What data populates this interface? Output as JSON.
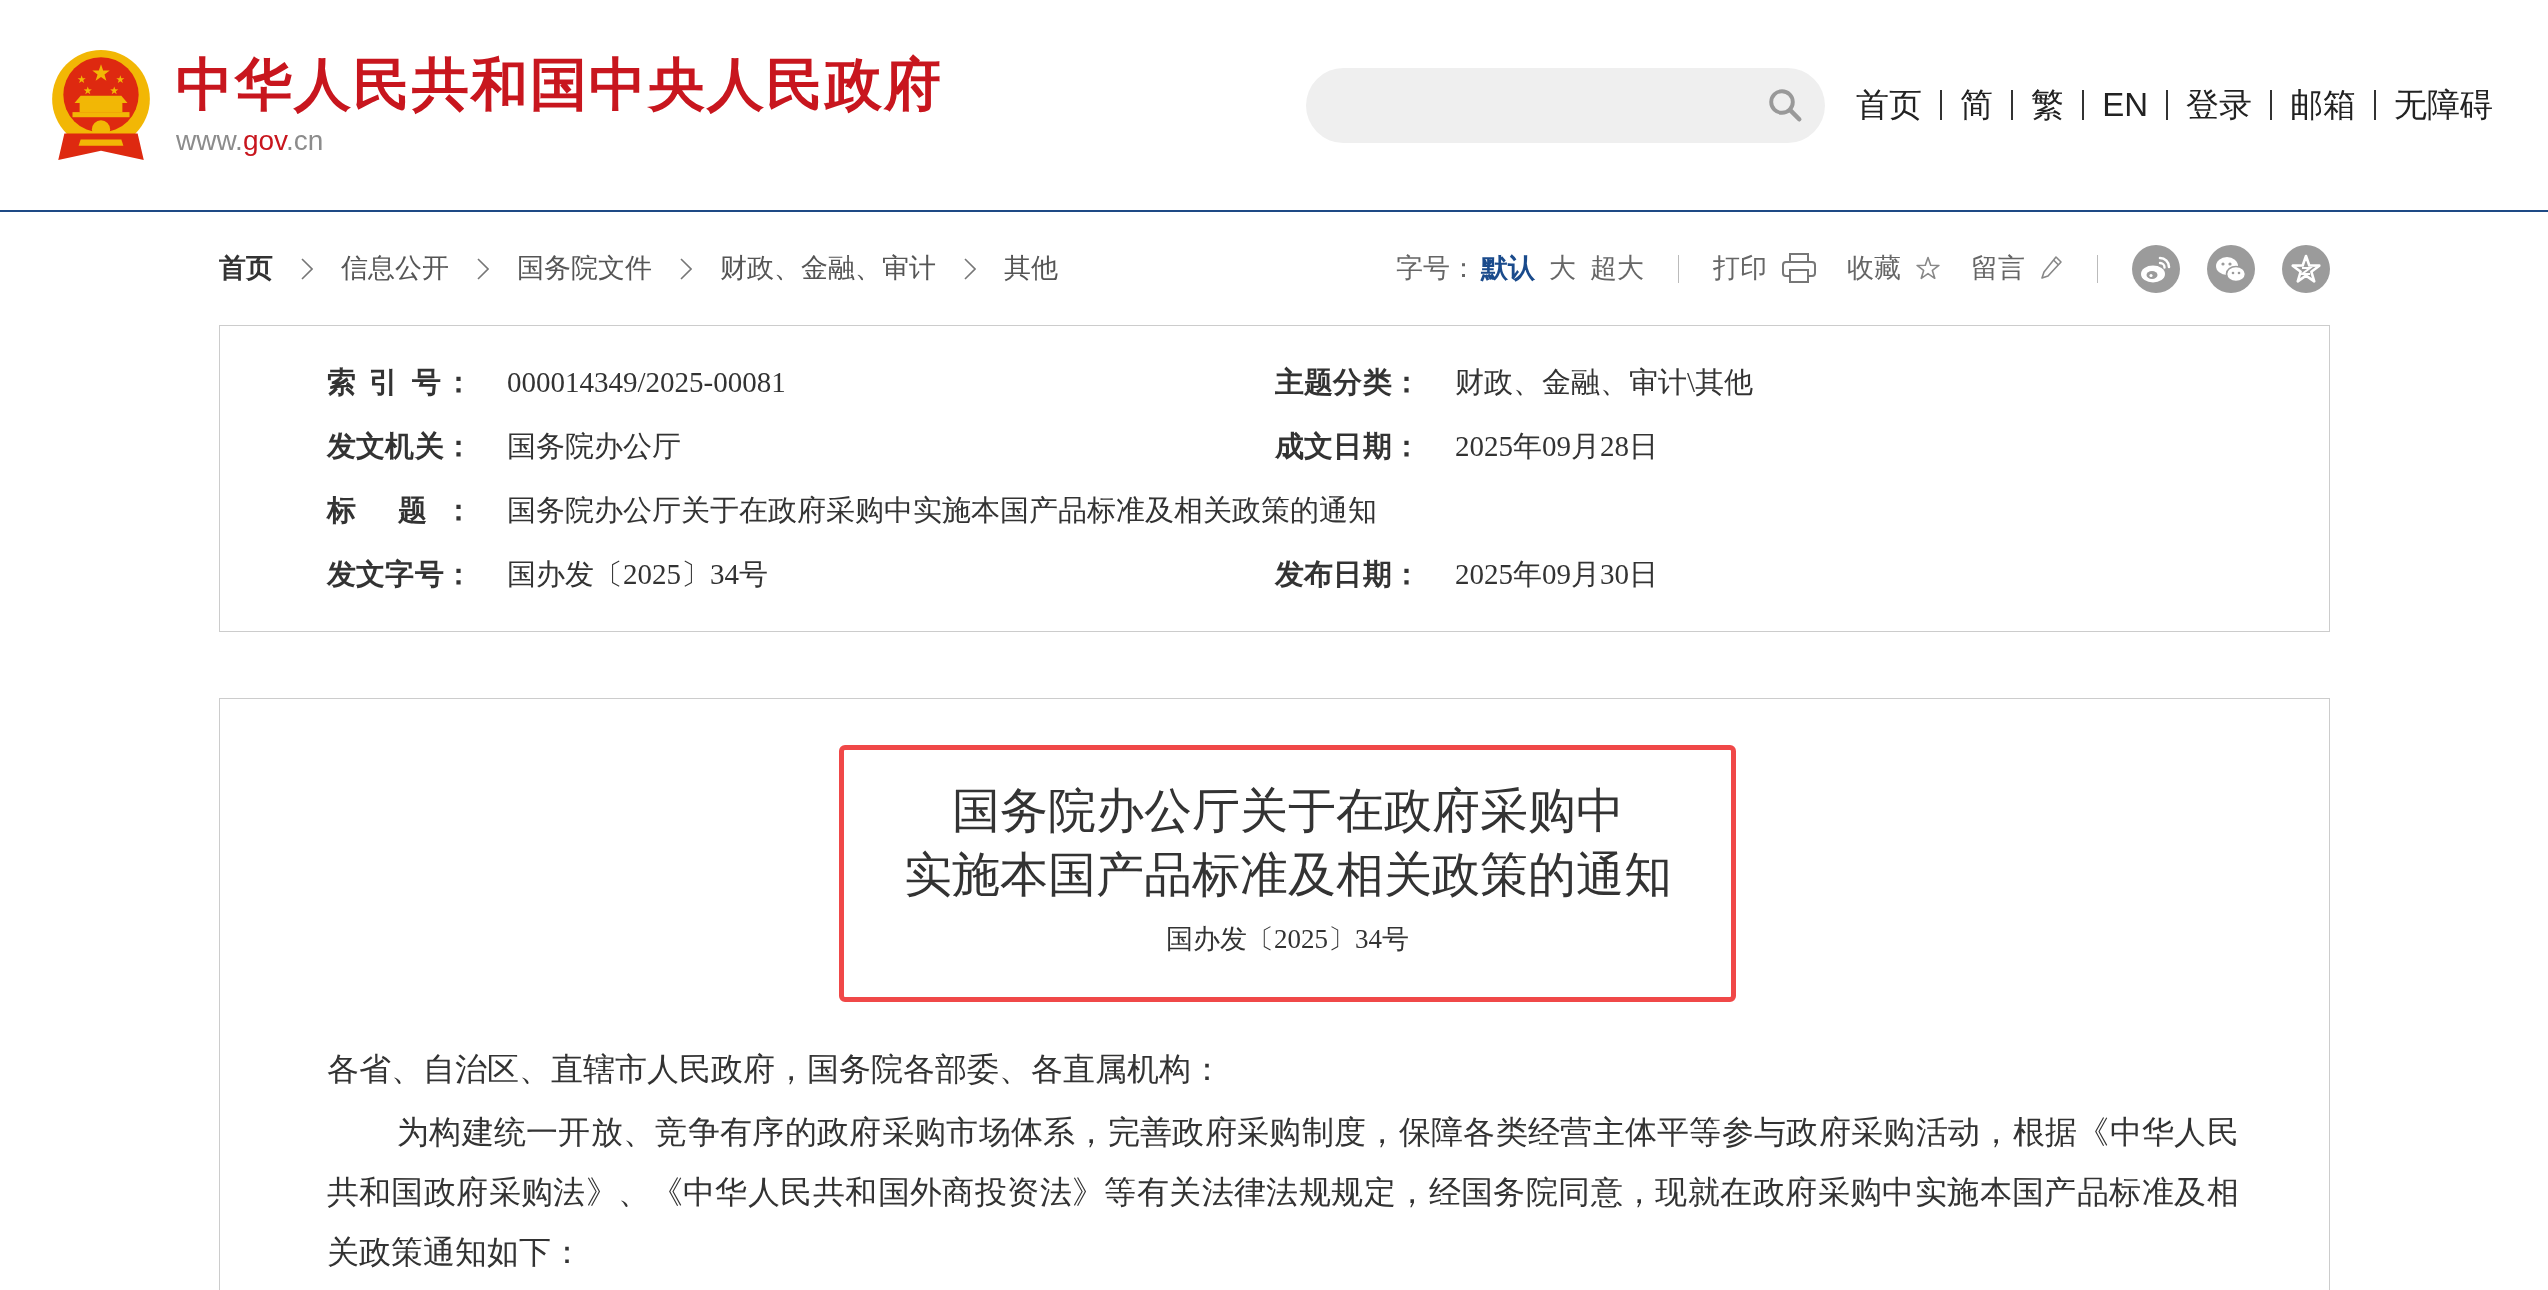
{
  "header": {
    "site_title": "中华人民共和国中央人民政府",
    "site_url": [
      {
        "text": "www.",
        "color": "#8c8c8c"
      },
      {
        "text": "gov",
        "color": "#c8161e"
      },
      {
        "text": ".cn",
        "color": "#8c8c8c"
      }
    ],
    "nav": [
      "首页",
      "简",
      "繁",
      "EN",
      "登录",
      "邮箱",
      "无障碍"
    ]
  },
  "breadcrumb": [
    "首页",
    "信息公开",
    "国务院文件",
    "财政、金融、审计",
    "其他"
  ],
  "toolbar": {
    "font_size_label": "字号：",
    "font_sizes": [
      {
        "label": "默认",
        "selected": true
      },
      {
        "label": "大",
        "selected": false
      },
      {
        "label": "超大",
        "selected": false
      }
    ],
    "actions": [
      {
        "label": "打印",
        "kind": "print"
      },
      {
        "label": "收藏",
        "kind": "favorite"
      },
      {
        "label": "留言",
        "kind": "comment"
      }
    ]
  },
  "info_table": {
    "rows": [
      [
        {
          "label": "索 引 号：",
          "value": "000014349/2025-00081"
        },
        {
          "label": "主题分类：",
          "value": "财政、金融、审计\\其他"
        }
      ],
      [
        {
          "label": "发文机关：",
          "value": "国务院办公厅"
        },
        {
          "label": "成文日期：",
          "value": "2025年09月28日"
        }
      ],
      [
        {
          "label": "标 题：",
          "value": "国务院办公厅关于在政府采购中实施本国产品标准及相关政策的通知"
        }
      ],
      [
        {
          "label": "发文字号：",
          "value": "国办发〔2025〕34号"
        },
        {
          "label": "发布日期：",
          "value": "2025年09月30日"
        }
      ]
    ]
  },
  "document": {
    "highlighted": true,
    "title_lines": [
      "国务院办公厅关于在政府采购中",
      "实施本国产品标准及相关政策的通知"
    ],
    "doc_number": "国办发〔2025〕34号",
    "paragraphs": [
      {
        "kind": "salutation",
        "text": "各省、自治区、直辖市人民政府，国务院各部委、各直属机构："
      },
      {
        "kind": "body",
        "text": "为构建统一开放、竞争有序的政府采购市场体系，完善政府采购制度，保障各类经营主体平等参与政府采购活动，根据《中华人民共和国政府采购法》、《中华人民共和国外商投资法》等有关法律法规规定，经国务院同意，现就在政府采购中实施本国产品标准及相关政策通知如下："
      }
    ]
  }
}
